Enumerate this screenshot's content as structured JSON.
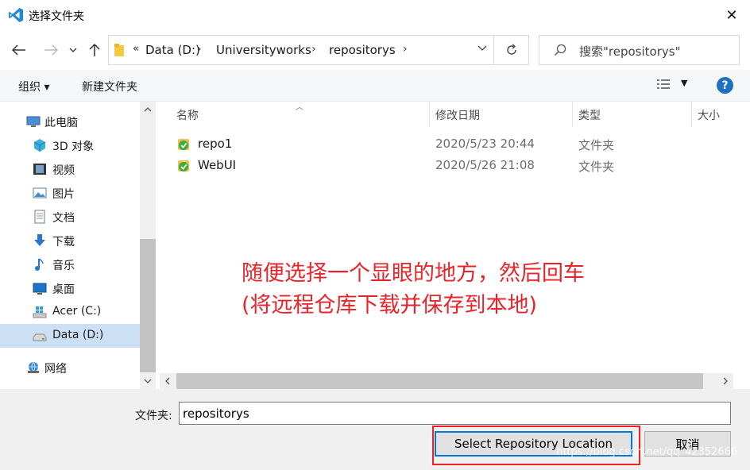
{
  "window": {
    "title": "选择文件夹"
  },
  "address": {
    "overflow": "«",
    "crumbs": [
      "Data (D:)",
      "Universityworks",
      "repositorys"
    ]
  },
  "search": {
    "placeholder": "搜索\"repositorys\""
  },
  "toolbar": {
    "organize": "组织 ▾",
    "new_folder": "新建文件夹"
  },
  "nav": {
    "items": [
      {
        "label": "此电脑",
        "icon": "computer-icon"
      },
      {
        "label": "3D 对象",
        "icon": "cube-icon"
      },
      {
        "label": "视频",
        "icon": "video-icon"
      },
      {
        "label": "图片",
        "icon": "picture-icon"
      },
      {
        "label": "文档",
        "icon": "document-icon"
      },
      {
        "label": "下载",
        "icon": "download-icon"
      },
      {
        "label": "音乐",
        "icon": "music-icon"
      },
      {
        "label": "桌面",
        "icon": "desktop-icon"
      },
      {
        "label": "Acer (C:)",
        "icon": "windows-drive-icon"
      },
      {
        "label": "Data (D:)",
        "icon": "drive-icon"
      },
      {
        "label": "网络",
        "icon": "network-icon"
      }
    ]
  },
  "columns": {
    "name": "名称",
    "modified": "修改日期",
    "type": "类型",
    "size": "大小"
  },
  "rows": [
    {
      "name": "repo1",
      "modified": "2020/5/23 20:44",
      "type": "文件夹"
    },
    {
      "name": "WebUI",
      "modified": "2020/5/26 21:08",
      "type": "文件夹"
    }
  ],
  "annotation": {
    "line1": "随便选择一个显眼的地方，然后回车",
    "line2": "(将远程仓库下载并保存到本地)"
  },
  "footer": {
    "folder_label": "文件夹:",
    "folder_value": "repositorys",
    "select_button": "Select Repository Location",
    "cancel_button": "取消"
  },
  "watermark": "https://blog.csdn.net/qq_42352666",
  "colors": {
    "accent": "#0078d7",
    "annotation": "#e8242a",
    "selected": "#cce0f5"
  }
}
